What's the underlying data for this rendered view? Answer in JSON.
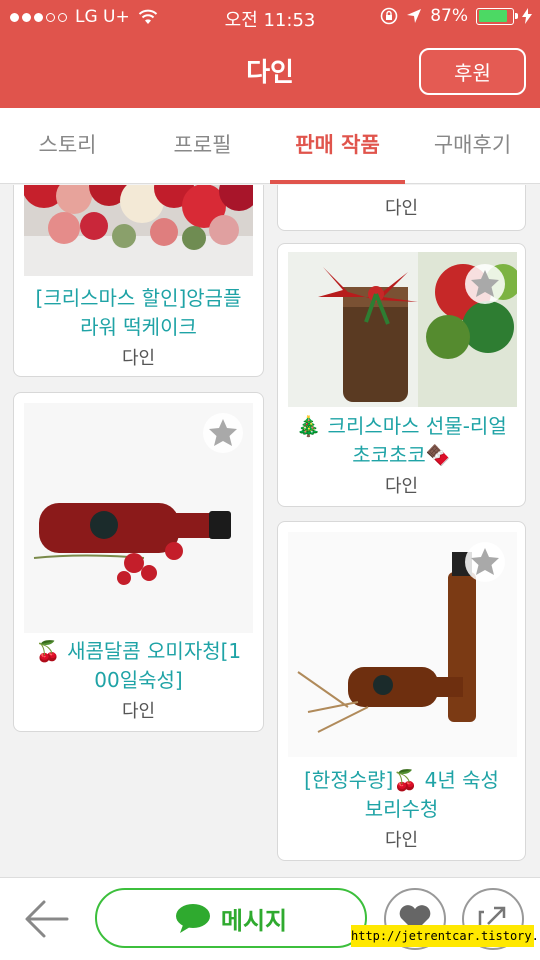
{
  "status_bar": {
    "carrier": "LG U+",
    "time": "오전 11:53",
    "battery": "87%"
  },
  "header": {
    "title": "다인",
    "sponsor_label": "후원"
  },
  "tabs": [
    {
      "label": "스토리",
      "active": false
    },
    {
      "label": "프로필",
      "active": false
    },
    {
      "label": "판매 작품",
      "active": true
    },
    {
      "label": "구매후기",
      "active": false
    }
  ],
  "products": [
    {
      "title_line1": "[크리스마스 할인]앙금플",
      "title_line2": "라워 떡케이크",
      "seller": "다인",
      "image": "flower-cake"
    },
    {
      "title_line1": "",
      "title_line2": "",
      "seller": "다인",
      "image": "partial"
    },
    {
      "title_line1": "🎄 크리스마스 선물-리얼",
      "title_line2": "초코초코🍫",
      "seller": "다인",
      "image": "choco-jar"
    },
    {
      "title_line1": "🍒 새콤달콤 오미자청[1",
      "title_line2": "00일숙성]",
      "seller": "다인",
      "image": "omija-bottle"
    },
    {
      "title_line1": "[한정수량]🍒 4년 숙성",
      "title_line2": "보리수청",
      "seller": "다인",
      "image": "borisu-bottle"
    }
  ],
  "bottom_bar": {
    "message_label": "메시지"
  },
  "watermark": "http://jetrentcar.tistory.com",
  "colors": {
    "brand": "#e0544c",
    "title_teal": "#1fa3a6",
    "message_green": "#3cbf3c",
    "battery_green": "#4cd964"
  }
}
